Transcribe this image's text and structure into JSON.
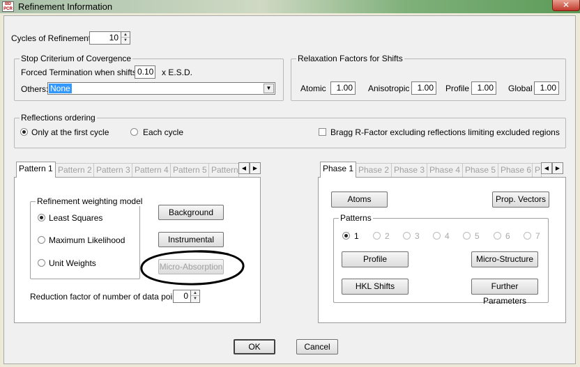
{
  "window": {
    "title": "Refinement Information",
    "icon_text": "BD\nPCR",
    "close_label": "✕"
  },
  "cycles": {
    "label": "Cycles of Refinement:",
    "value": "10"
  },
  "stop_criterium": {
    "legend": "Stop Criterium of Covergence",
    "forced_label": "Forced Termination when  shifts <",
    "forced_value": "0.10",
    "esd_label": "x  E.S.D.",
    "others_label": "Others:",
    "others_value": "None"
  },
  "relaxation": {
    "legend": "Relaxation Factors for Shifts",
    "atomic_label": "Atomic",
    "atomic_value": "1.00",
    "anisotropic_label": "Anisotropic",
    "anisotropic_value": "1.00",
    "profile_label": "Profile",
    "profile_value": "1.00",
    "global_label": "Global",
    "global_value": "1.00"
  },
  "reflections": {
    "legend": "Reflections ordering",
    "first_cycle_label": "Only at the first cycle",
    "each_cycle_label": "Each cycle",
    "bragg_label": "Bragg R-Factor excluding  reflections limiting excluded regions"
  },
  "pattern_tabs": [
    "Pattern 1",
    "Pattern 2",
    "Pattern 3",
    "Pattern 4",
    "Pattern 5",
    "Pattern"
  ],
  "weighting": {
    "legend": "Refinement weighting model",
    "least_squares": "Least Squares",
    "max_likelihood": "Maximum Likelihood",
    "unit_weights": "Unit Weights"
  },
  "pattern_buttons": {
    "background": "Background",
    "instrumental": "Instrumental",
    "micro_absorption": "Micro-Absorption"
  },
  "reduction": {
    "label": "Reduction factor of number of data points:",
    "value": "0"
  },
  "phase_tabs": [
    "Phase 1",
    "Phase 2",
    "Phase 3",
    "Phase 4",
    "Phase 5",
    "Phase 6",
    "P"
  ],
  "phase_buttons": {
    "atoms": "Atoms",
    "prop_vectors": "Prop. Vectors",
    "profile": "Profile",
    "micro_structure": "Micro-Structure",
    "hkl_shifts": "HKL Shifts",
    "further_parameters": "Further Parameters"
  },
  "patterns_group": {
    "legend": "Patterns",
    "items": [
      "1",
      "2",
      "3",
      "4",
      "5",
      "6",
      "7"
    ]
  },
  "footer": {
    "ok": "OK",
    "cancel": "Cancel"
  },
  "colors": {
    "selection": "#3399ff",
    "annotation": "#000000"
  }
}
